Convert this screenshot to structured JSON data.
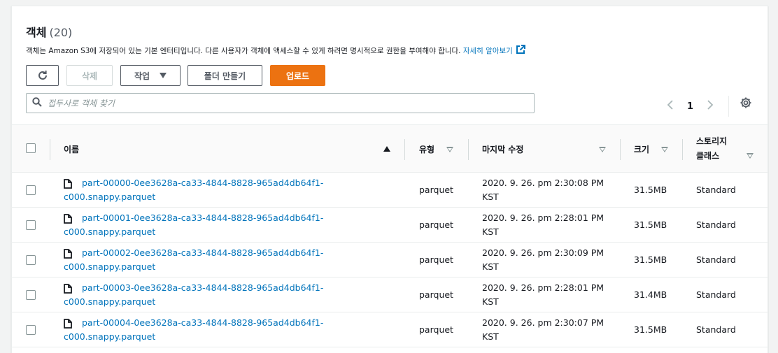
{
  "header": {
    "title": "객체",
    "count": "(20)",
    "description": "객체는 Amazon S3에 저장되어 있는 기본 엔터티입니다. 다른 사용자가 객체에 액세스할 수 있게 하려면 명시적으로 권한을 부여해야 합니다.",
    "learn_more": "자세히 알아보기"
  },
  "toolbar": {
    "refresh_icon": "refresh-icon",
    "delete_label": "삭제",
    "actions_label": "작업",
    "create_folder_label": "폴더 만들기",
    "upload_label": "업로드"
  },
  "search": {
    "placeholder": "접두사로 객체 찾기",
    "value": ""
  },
  "pagination": {
    "current_page": "1"
  },
  "table": {
    "columns": {
      "name": "이름",
      "type": "유형",
      "modified": "마지막 수정",
      "size": "크기",
      "storage_class_line1": "스토리지",
      "storage_class_line2": "클래스"
    },
    "rows": [
      {
        "name": "part-00000-0ee3628a-ca33-4844-8828-965ad4db64f1-c000.snappy.parquet",
        "type": "parquet",
        "modified_line1": "2020. 9. 26. pm 2:30:08 PM",
        "modified_line2": "KST",
        "size": "31.5MB",
        "storage_class": "Standard"
      },
      {
        "name": "part-00001-0ee3628a-ca33-4844-8828-965ad4db64f1-c000.snappy.parquet",
        "type": "parquet",
        "modified_line1": "2020. 9. 26. pm 2:28:01 PM",
        "modified_line2": "KST",
        "size": "31.5MB",
        "storage_class": "Standard"
      },
      {
        "name": "part-00002-0ee3628a-ca33-4844-8828-965ad4db64f1-c000.snappy.parquet",
        "type": "parquet",
        "modified_line1": "2020. 9. 26. pm 2:30:09 PM",
        "modified_line2": "KST",
        "size": "31.5MB",
        "storage_class": "Standard"
      },
      {
        "name": "part-00003-0ee3628a-ca33-4844-8828-965ad4db64f1-c000.snappy.parquet",
        "type": "parquet",
        "modified_line1": "2020. 9. 26. pm 2:28:01 PM",
        "modified_line2": "KST",
        "size": "31.4MB",
        "storage_class": "Standard"
      },
      {
        "name": "part-00004-0ee3628a-ca33-4844-8828-965ad4db64f1-c000.snappy.parquet",
        "type": "parquet",
        "modified_line1": "2020. 9. 26. pm 2:30:07 PM",
        "modified_line2": "KST",
        "size": "31.5MB",
        "storage_class": "Standard"
      }
    ]
  },
  "colors": {
    "primary": "#ec7211",
    "link": "#0073bb",
    "text": "#16191f"
  }
}
